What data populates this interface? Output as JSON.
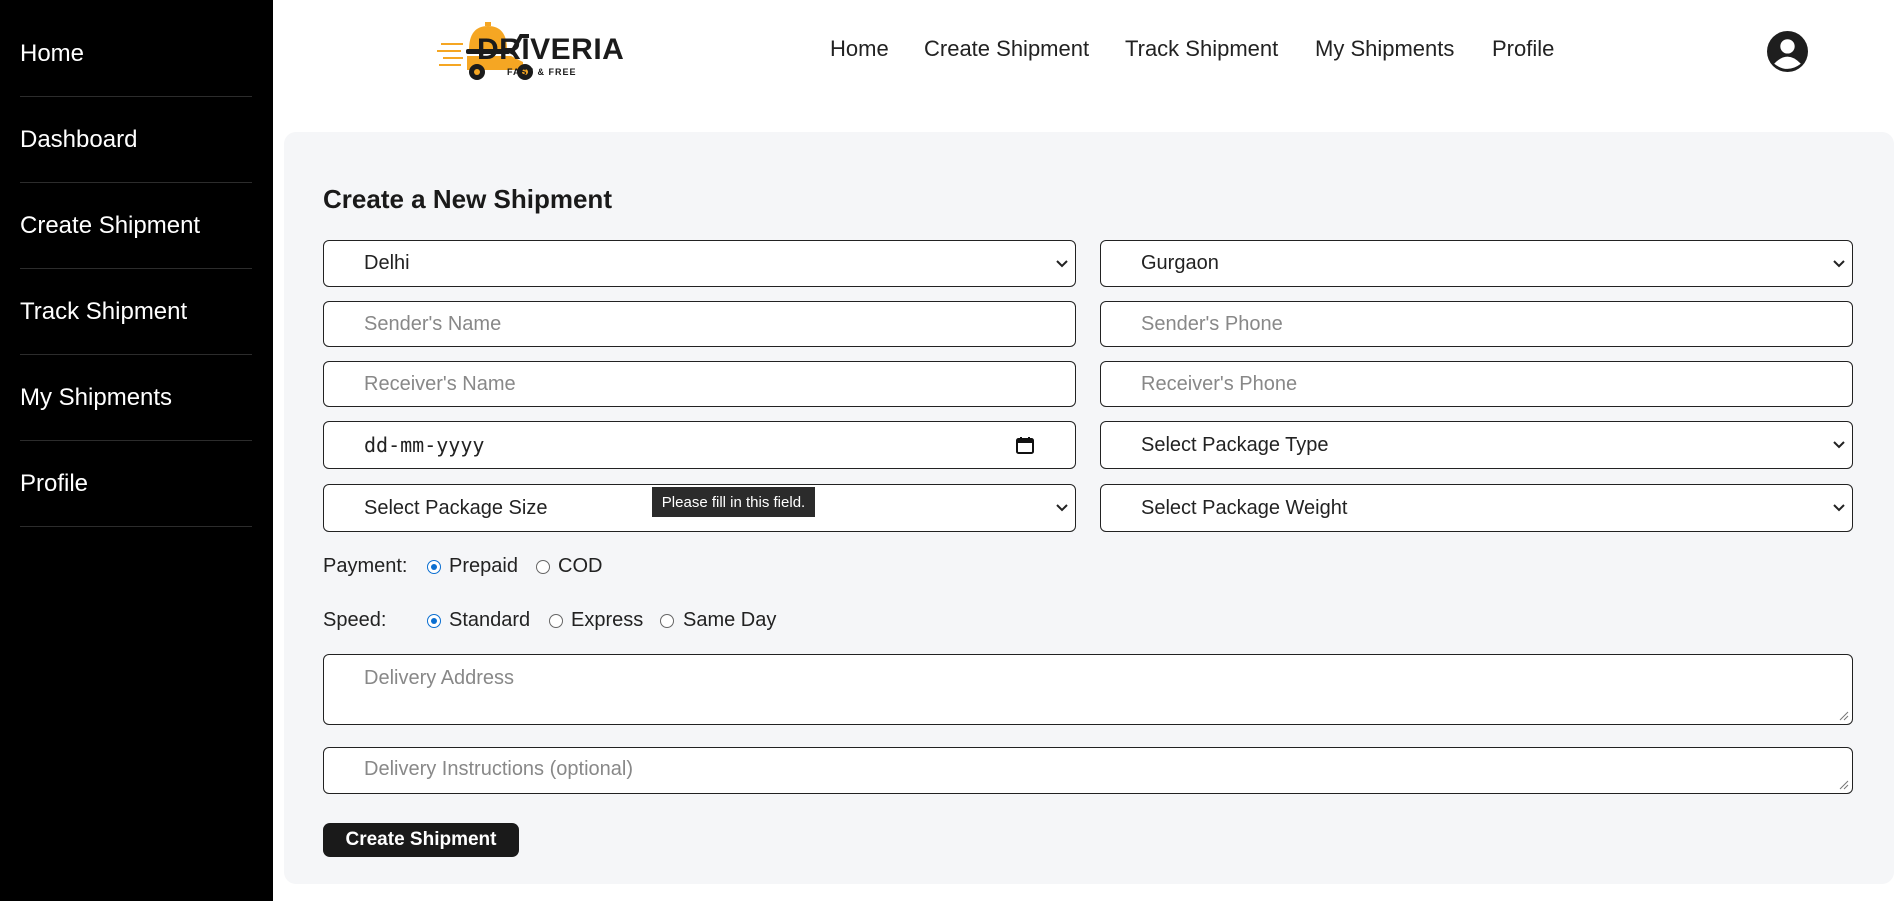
{
  "sidebar": {
    "items": [
      {
        "label": "Home"
      },
      {
        "label": "Dashboard"
      },
      {
        "label": "Create Shipment"
      },
      {
        "label": "Track Shipment"
      },
      {
        "label": "My Shipments"
      },
      {
        "label": "Profile"
      }
    ]
  },
  "header": {
    "brand": "DRIVERIA",
    "tagline": "FAST & FREE",
    "nav": [
      {
        "label": "Home"
      },
      {
        "label": "Create Shipment"
      },
      {
        "label": "Track Shipment"
      },
      {
        "label": "My Shipments"
      },
      {
        "label": "Profile"
      }
    ],
    "avatar_icon": "user-circle-icon"
  },
  "form": {
    "title": "Create a New Shipment",
    "from_city": "Delhi",
    "to_city": "Gurgaon",
    "sender_name_placeholder": "Sender's Name",
    "sender_phone_placeholder": "Sender's Phone",
    "receiver_name_placeholder": "Receiver's Name",
    "receiver_phone_placeholder": "Receiver's Phone",
    "date_placeholder": "dd-mm-yyyy",
    "package_type": "Select Package Type",
    "package_size": "Select Package Size",
    "package_weight": "Select Package Weight",
    "tooltip": "Please fill in this field.",
    "payment": {
      "label": "Payment:",
      "options": [
        {
          "label": "Prepaid",
          "checked": true
        },
        {
          "label": "COD",
          "checked": false
        }
      ]
    },
    "speed": {
      "label": "Speed:",
      "options": [
        {
          "label": "Standard",
          "checked": true
        },
        {
          "label": "Express",
          "checked": false
        },
        {
          "label": "Same Day",
          "checked": false
        }
      ]
    },
    "address_placeholder": "Delivery Address",
    "instructions_placeholder": "Delivery Instructions (optional)",
    "submit_label": "Create Shipment"
  },
  "colors": {
    "sidebar_bg": "#000000",
    "accent_orange": "#f5a623",
    "radio_blue": "#0b6fd1",
    "button_bg": "#1a1a1a"
  }
}
